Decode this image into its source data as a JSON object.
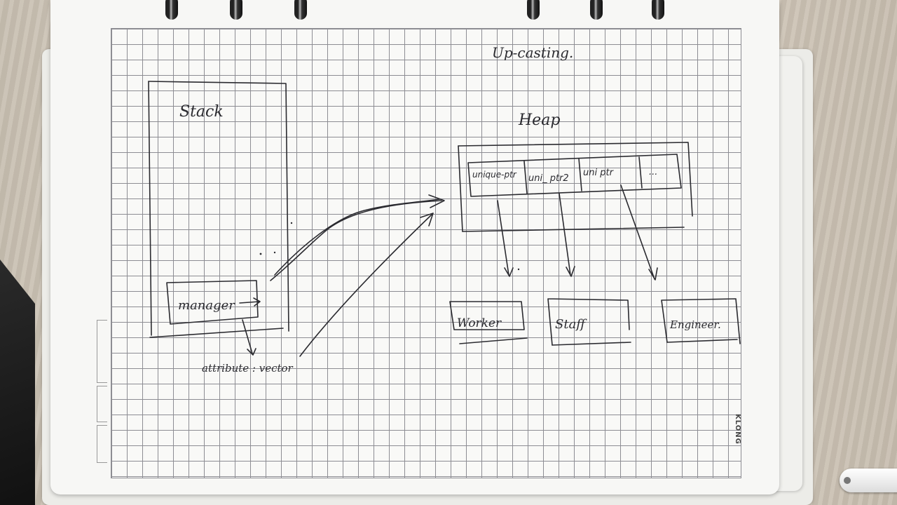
{
  "diagram": {
    "title": "Up-casting.",
    "stack": {
      "label": "Stack"
    },
    "heap": {
      "label": "Heap"
    },
    "manager": {
      "label": "manager"
    },
    "vector_annotation": {
      "label": "attribute : vector"
    },
    "pointers": [
      {
        "label": "unique-ptr"
      },
      {
        "label": "uni_ ptr2"
      },
      {
        "label": "uni ptr"
      },
      {
        "label": "..."
      }
    ],
    "objects": [
      {
        "label": "Worker"
      },
      {
        "label": "Staff"
      },
      {
        "label": "Engineer."
      }
    ]
  },
  "notebook": {
    "brand": "KLONG"
  }
}
